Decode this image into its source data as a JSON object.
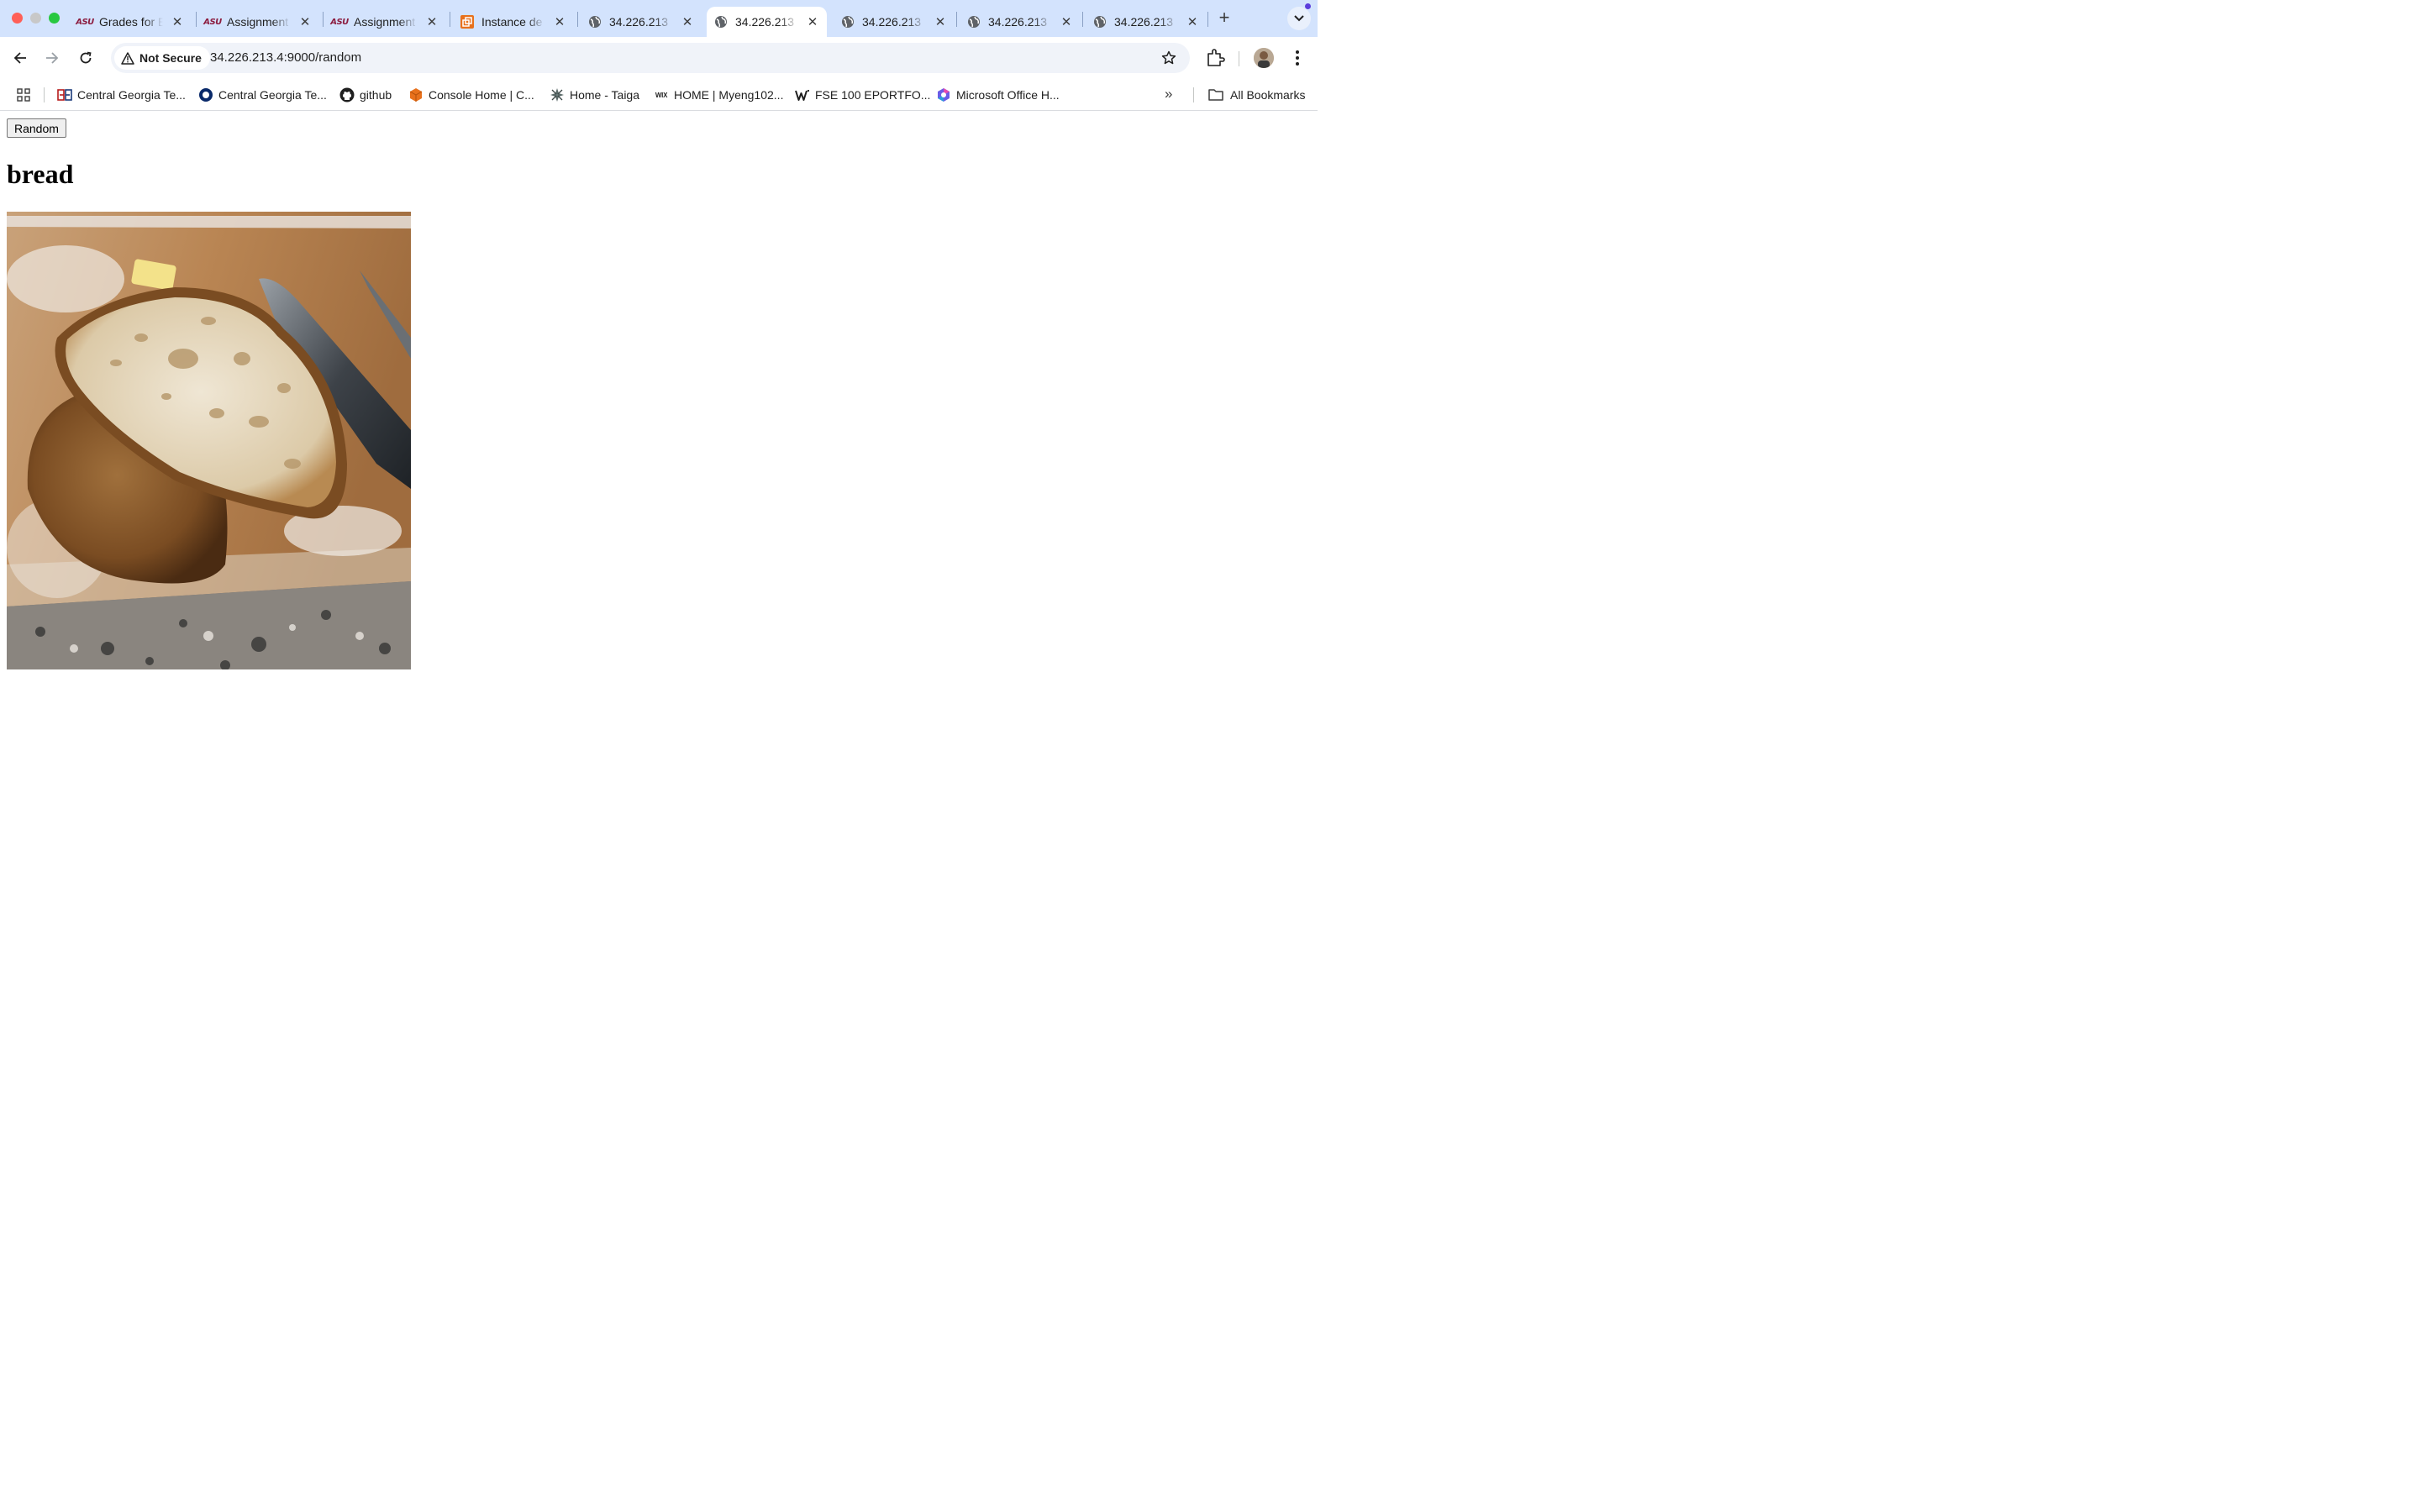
{
  "browser": {
    "tabs": [
      {
        "title": "Grades for E",
        "icon": "asu-logo",
        "active": false
      },
      {
        "title": "Assignment",
        "icon": "asu-logo",
        "active": false
      },
      {
        "title": "Assignment",
        "icon": "asu-logo",
        "active": false
      },
      {
        "title": "Instance de",
        "icon": "aws-icon",
        "active": false
      },
      {
        "title": "34.226.213",
        "icon": "globe-icon",
        "active": false
      },
      {
        "title": "34.226.213",
        "icon": "globe-icon",
        "active": true
      },
      {
        "title": "34.226.213",
        "icon": "globe-icon",
        "active": false
      },
      {
        "title": "34.226.213",
        "icon": "globe-icon",
        "active": false
      },
      {
        "title": "34.226.213",
        "icon": "globe-icon",
        "active": false
      }
    ],
    "asu_logo_text": "ASU",
    "security_label": "Not Secure",
    "url": "34.226.213.4:9000/random",
    "bookmarks": [
      {
        "label": "Central Georgia Te...",
        "icon": "cgtc-icon"
      },
      {
        "label": "Central Georgia Te...",
        "icon": "ring-icon"
      },
      {
        "label": "github",
        "icon": "github-icon"
      },
      {
        "label": "Console Home | C...",
        "icon": "aws-cube-icon"
      },
      {
        "label": "Home - Taiga",
        "icon": "taiga-icon"
      },
      {
        "label": "HOME | Myeng102...",
        "icon": "wix-icon"
      },
      {
        "label": "FSE 100 EPORTFO...",
        "icon": "weebly-icon"
      },
      {
        "label": "Microsoft Office H...",
        "icon": "m365-icon"
      }
    ],
    "wix_icon_text": "WIX",
    "all_bookmarks_label": "All Bookmarks",
    "colors": {
      "tabstrip": "#d3e3fd",
      "omnibox": "#f0f3f9"
    }
  },
  "page": {
    "button_label": "Random",
    "heading": "bread",
    "image_subject": "bread"
  }
}
